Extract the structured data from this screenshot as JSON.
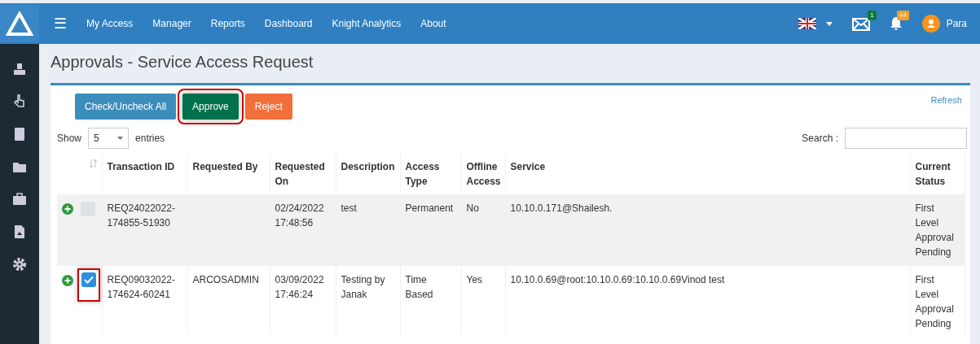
{
  "navbar": {
    "menu_icon": "☰",
    "links": [
      "My Access",
      "Manager",
      "Reports",
      "Dashboard",
      "Knight Analytics",
      "About"
    ],
    "mail_count": "1",
    "notification_count": "44",
    "user": "Para"
  },
  "sidebar": {
    "items": [
      {
        "kind": "stamp"
      },
      {
        "kind": "hand"
      },
      {
        "kind": "book"
      },
      {
        "kind": "folder"
      },
      {
        "kind": "briefcase"
      },
      {
        "kind": "upload"
      },
      {
        "kind": "gear"
      }
    ]
  },
  "page_title": "Approvals - Service Access Request",
  "toolbar": {
    "buttons": [
      {
        "label": "Check/Uncheck All",
        "kind": "primary",
        "highlighted": false
      },
      {
        "label": "Approve",
        "kind": "success",
        "highlighted": true
      },
      {
        "label": "Reject",
        "kind": "danger",
        "highlighted": false
      }
    ],
    "refresh": "Refresh"
  },
  "length_menu": {
    "before": "Show",
    "value": "5",
    "after": "entries"
  },
  "search": {
    "label": "Search :"
  },
  "table": {
    "columns": [
      "Transaction ID",
      "Requested By",
      "Requested On",
      "Description",
      "Access Type",
      "Offline Access",
      "Service",
      "Current Status"
    ],
    "rows": [
      {
        "checked": false,
        "highlighted": false,
        "transaction_id": "REQ24022022-174855-51930",
        "requested_on": "02/24/2022 17:48:56",
        "description": "test",
        "access_type": "Permanent",
        "offline_access": "No",
        "service": "10.10.0.171@Shailesh.",
        "status": "First Level Approval Pending"
      },
      {
        "checked": true,
        "highlighted": true,
        "transaction_id": "REQ09032022-174624-60241",
        "requested_by": "ARCOSADMIN",
        "requested_on": "03/09/2022 17:46:24",
        "description": "Testing by Janak",
        "access_type": "Time Based",
        "offline_access": "Yes",
        "service": "10.10.0.69@root:10.10.0.69:10.10.0.69Vinod test",
        "status": "First Level Approval Pending"
      }
    ]
  }
}
